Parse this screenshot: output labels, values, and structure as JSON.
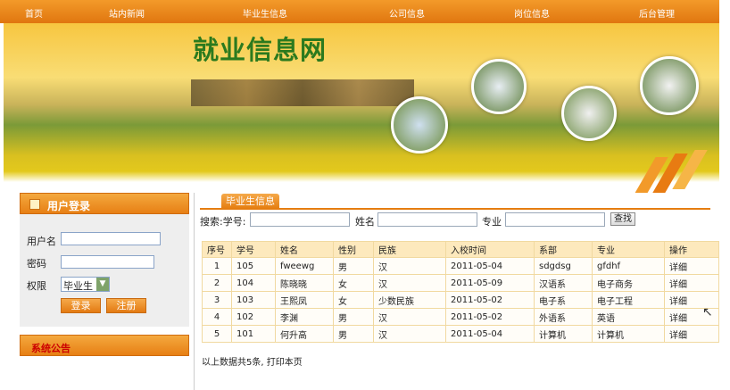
{
  "nav": {
    "items": [
      "首页",
      "站内新闻",
      "毕业生信息",
      "公司信息",
      "岗位信息",
      "后台管理"
    ]
  },
  "banner": {
    "title": "就业信息网"
  },
  "login": {
    "title": "用户登录",
    "username_label": "用户名",
    "password_label": "密码",
    "role_label": "权限",
    "role_selected": "毕业生",
    "login_button": "登录",
    "register_button": "注册"
  },
  "notice": {
    "title": "系统公告"
  },
  "main": {
    "tab_label": "毕业生信息",
    "search": {
      "prefix": "搜索:学号:",
      "name_label": "姓名",
      "major_label": "专业",
      "button": "查找"
    },
    "table": {
      "headers": [
        "序号",
        "学号",
        "姓名",
        "性别",
        "民族",
        "入校时间",
        "系部",
        "专业",
        "操作"
      ],
      "rows": [
        [
          "1",
          "105",
          "fweewg",
          "男",
          "汉",
          "2011-05-04",
          "sdgdsg",
          "gfdhf",
          "详细"
        ],
        [
          "2",
          "104",
          "陈晓晓",
          "女",
          "汉",
          "2011-05-09",
          "汉语系",
          "电子商务",
          "详细"
        ],
        [
          "3",
          "103",
          "王熙凤",
          "女",
          "少数民族",
          "2011-05-02",
          "电子系",
          "电子工程",
          "详细"
        ],
        [
          "4",
          "102",
          "李渊",
          "男",
          "汉",
          "2011-05-02",
          "外语系",
          "英语",
          "详细"
        ],
        [
          "5",
          "101",
          "何升高",
          "男",
          "汉",
          "2011-05-04",
          "计算机",
          "计算机",
          "详细"
        ]
      ]
    },
    "footer": "以上数据共5条, 打印本页"
  },
  "colors": {
    "accent": "#e57d10",
    "header_row": "#fde9bd",
    "title_green": "#2b7a1e"
  }
}
